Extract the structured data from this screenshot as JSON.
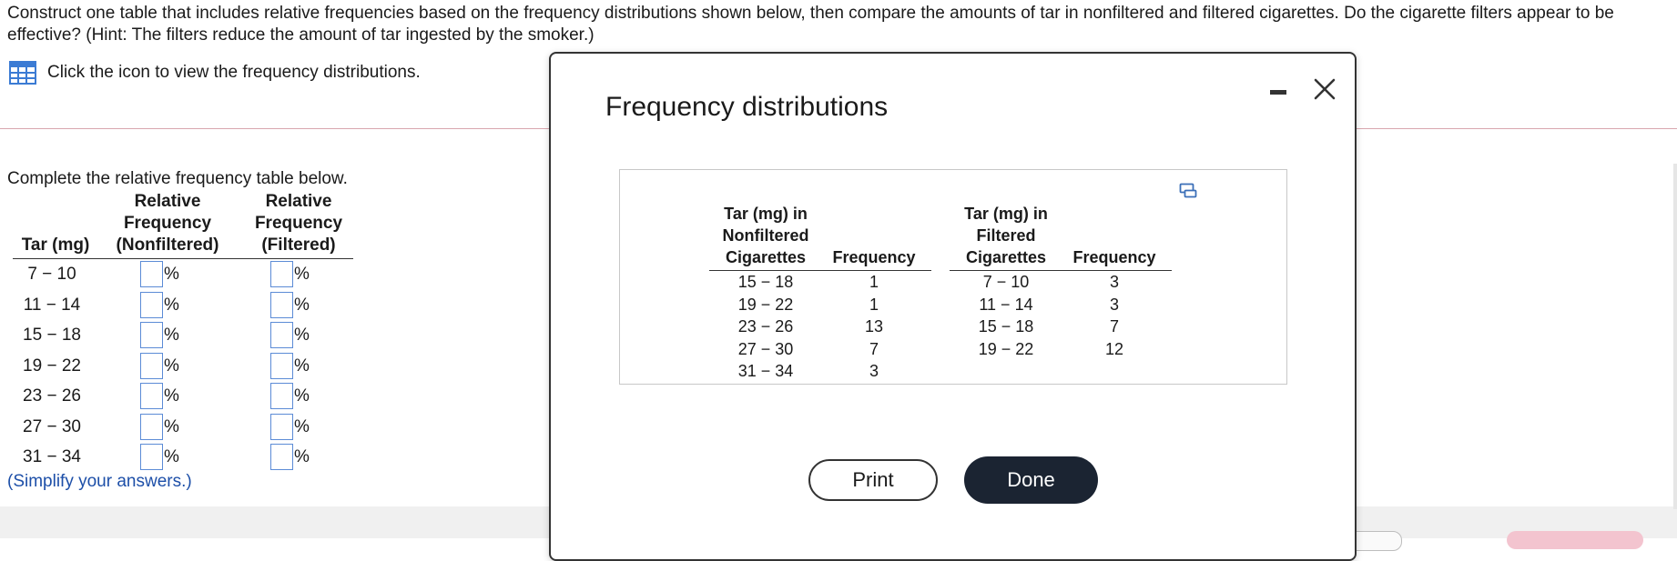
{
  "question": {
    "text": "Construct one table that includes relative frequencies based on the frequency distributions shown below, then compare the amounts of tar in nonfiltered and filtered cigarettes. Do the cigarette filters appear to be effective? (Hint: The filters reduce the amount of tar ingested by the smoker.)",
    "icon_link_text": "Click the icon to view the frequency distributions."
  },
  "answer": {
    "instruction": "Complete the relative frequency table below.",
    "headers": {
      "tar": "Tar (mg)",
      "nonfiltered_line1": "Relative",
      "nonfiltered_line2": "Frequency",
      "nonfiltered_line3": "(Nonfiltered)",
      "filtered_line1": "Relative",
      "filtered_line2": "Frequency",
      "filtered_line3": "(Filtered)"
    },
    "percent_symbol": "%",
    "rows": [
      {
        "range": "7 − 10",
        "nonfiltered_value": "",
        "filtered_value": ""
      },
      {
        "range": "11 − 14",
        "nonfiltered_value": "",
        "filtered_value": ""
      },
      {
        "range": "15 − 18",
        "nonfiltered_value": "",
        "filtered_value": ""
      },
      {
        "range": "19 − 22",
        "nonfiltered_value": "",
        "filtered_value": ""
      },
      {
        "range": "23 − 26",
        "nonfiltered_value": "",
        "filtered_value": ""
      },
      {
        "range": "27 − 30",
        "nonfiltered_value": "",
        "filtered_value": ""
      },
      {
        "range": "31 − 34",
        "nonfiltered_value": "",
        "filtered_value": ""
      }
    ],
    "simplify_note": "(Simplify your answers.)"
  },
  "modal": {
    "title": "Frequency distributions",
    "nonfiltered": {
      "header_line1": "Tar (mg) in",
      "header_line2": "Nonfiltered",
      "header_line3": "Cigarettes",
      "freq_header": "Frequency",
      "rows": [
        {
          "range": "15 − 18",
          "frequency": "1"
        },
        {
          "range": "19 − 22",
          "frequency": "1"
        },
        {
          "range": "23 − 26",
          "frequency": "13"
        },
        {
          "range": "27 − 30",
          "frequency": "7"
        },
        {
          "range": "31 − 34",
          "frequency": "3"
        }
      ]
    },
    "filtered": {
      "header_line1": "Tar (mg) in",
      "header_line2": "Filtered",
      "header_line3": "Cigarettes",
      "freq_header": "Frequency",
      "rows": [
        {
          "range": "7 − 10",
          "frequency": "3"
        },
        {
          "range": "11 − 14",
          "frequency": "3"
        },
        {
          "range": "15 − 18",
          "frequency": "7"
        },
        {
          "range": "19 − 22",
          "frequency": "12"
        }
      ]
    },
    "print_label": "Print",
    "done_label": "Done",
    "icons": {
      "minimize": "minimize-icon",
      "close": "close-icon",
      "copy": "copy-icon"
    }
  },
  "colors": {
    "input_border": "#5b8bd6",
    "link_blue": "#1d4fa8",
    "done_bg": "#1b2432",
    "divider": "#d9a6ae"
  }
}
